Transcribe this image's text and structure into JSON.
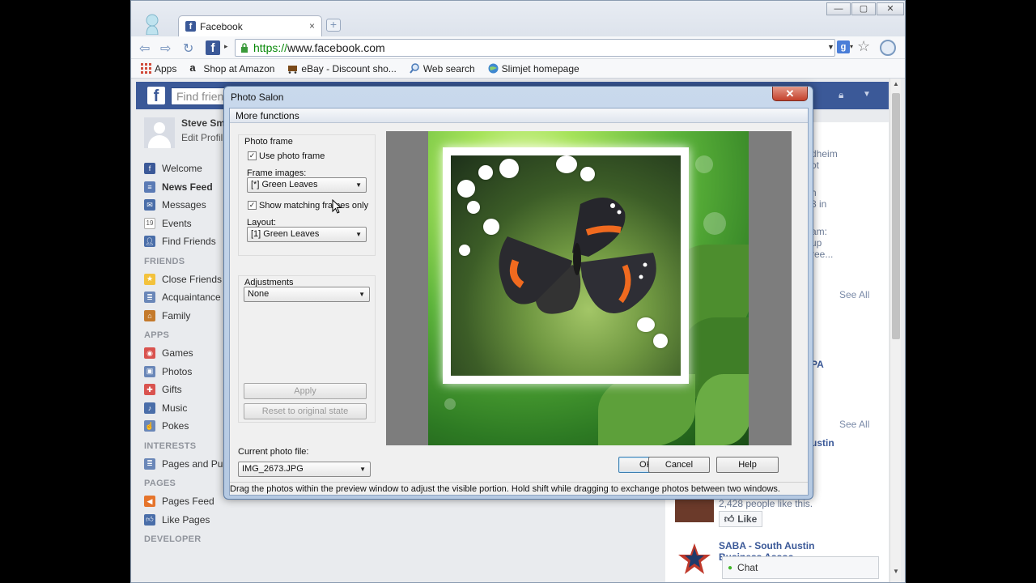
{
  "browser": {
    "tab_title": "Facebook",
    "tab_close": "×",
    "new_tab": "+",
    "url_scheme": "https://",
    "url_host": "www.facebook.com",
    "bookmarks": [
      {
        "label": "Apps",
        "icon": "apps-grid-icon"
      },
      {
        "label": "Shop at Amazon",
        "icon": "amazon-icon"
      },
      {
        "label": "eBay - Discount sho...",
        "icon": "cart-icon"
      },
      {
        "label": "Web search",
        "icon": "search-icon"
      },
      {
        "label": "Slimjet homepage",
        "icon": "globe-icon"
      }
    ]
  },
  "facebook": {
    "search_placeholder": "Find frien",
    "profile_name": "Steve Sm",
    "profile_edit": "Edit Profil",
    "nav": [
      {
        "label": "Welcome",
        "color": "#3b5998"
      },
      {
        "label": "News Feed",
        "color": "#5b7bb5",
        "bold": true
      },
      {
        "label": "Messages",
        "color": "#4a6ea9"
      },
      {
        "label": "Events",
        "color": "#8a8d91"
      },
      {
        "label": "Find Friends",
        "color": "#4a6ea9"
      }
    ],
    "sections": {
      "friends": "FRIENDS",
      "apps": "APPS",
      "interests": "INTERESTS",
      "pages": "PAGES",
      "developer": "DEVELOPER"
    },
    "friends_items": [
      "Close Friends",
      "Acquaintance",
      "Family"
    ],
    "apps_items": [
      "Games",
      "Photos",
      "Gifts",
      "Music",
      "Pokes"
    ],
    "interests_items": [
      "Pages and Pu"
    ],
    "pages_items": [
      "Pages Feed",
      "Like Pages"
    ],
    "right": {
      "frag1": "dheim",
      "frag2": "ot",
      "frag3": "n",
      "frag4": "8 in",
      "frag5": "am:",
      "frag6": "up",
      "frag7": "ree...",
      "see_all_1": "See All",
      "frag8": "PA",
      "see_all_2": "See All",
      "frag9": "ustin",
      "likes_text": "2,428 people like this.",
      "like_label": "Like",
      "saba_title": "SABA - South Austin",
      "saba_sub": "Business Assoc"
    },
    "chat_label": "Chat"
  },
  "dialog": {
    "title": "Photo Salon",
    "close": "✕",
    "more_functions": "More functions",
    "photo_frame_label": "Photo frame",
    "use_photo_frame": "Use photo frame",
    "frame_images_label": "Frame images:",
    "frame_images_value": "[*] Green Leaves",
    "show_matching": "Show matching frames only",
    "layout_label": "Layout:",
    "layout_value": "[1] Green Leaves",
    "adjustments_label": "Adjustments",
    "adjustments_value": "None",
    "apply_label": "Apply",
    "reset_label": "Reset to original state",
    "current_file_label": "Current photo file:",
    "current_file_value": "IMG_2673.JPG",
    "ok_label": "OK",
    "cancel_label": "Cancel",
    "help_label": "Help",
    "status_text": "Drag the photos within the preview window to adjust the visible portion. Hold shift while dragging to exchange photos between two windows."
  }
}
